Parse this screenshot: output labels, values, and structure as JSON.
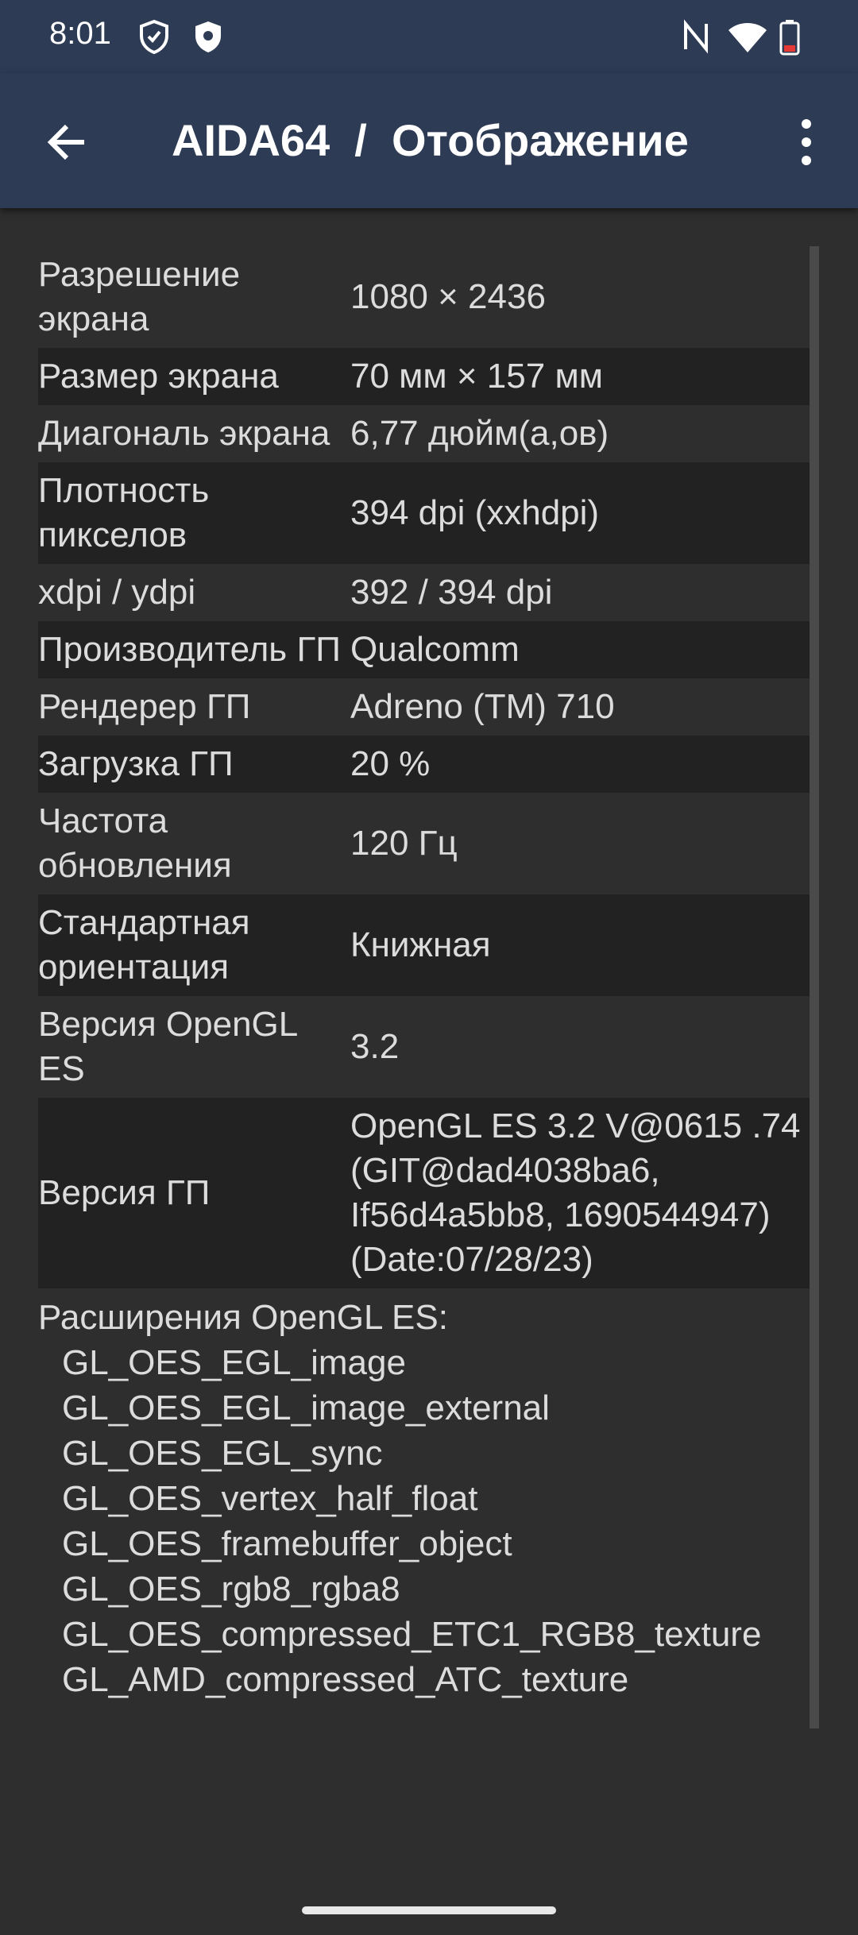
{
  "status_bar": {
    "time": "8:01"
  },
  "app_bar": {
    "title": "AIDA64  /  Отображение"
  },
  "rows": [
    {
      "label": "Разрешение экрана",
      "value": "1080 × 2436"
    },
    {
      "label": "Размер экрана",
      "value": "70 мм × 157 мм"
    },
    {
      "label": "Диагональ экрана",
      "value": "6,77 дюйм(а,ов)"
    },
    {
      "label": "Плотность пикселов",
      "value": "394 dpi (xxhdpi)"
    },
    {
      "label": "xdpi / ydpi",
      "value": "392 / 394 dpi"
    },
    {
      "label": "Производитель ГП",
      "value": "Qualcomm"
    },
    {
      "label": "Рендерер ГП",
      "value": "Adreno (TM) 710"
    },
    {
      "label": "Загрузка ГП",
      "value": "20 %"
    },
    {
      "label": "Частота обновления",
      "value": "120 Гц"
    },
    {
      "label": "Стандартная ориентация",
      "value": "Книжная"
    },
    {
      "label": "Версия OpenGL ES",
      "value": "3.2"
    },
    {
      "label": "Версия ГП",
      "value": "OpenGL ES 3.2 V@0615 .74 (GIT@dad4038ba6, If56d4a5bb8, 1690544947) (Date:07/28/23)"
    }
  ],
  "extensions": {
    "header": "Расширения OpenGL ES:",
    "items": [
      "GL_OES_EGL_image",
      "GL_OES_EGL_image_external",
      "GL_OES_EGL_sync",
      "GL_OES_vertex_half_float",
      "GL_OES_framebuffer_object",
      "GL_OES_rgb8_rgba8",
      "GL_OES_compressed_ETC1_RGB8_texture",
      "GL_AMD_compressed_ATC_texture"
    ]
  }
}
